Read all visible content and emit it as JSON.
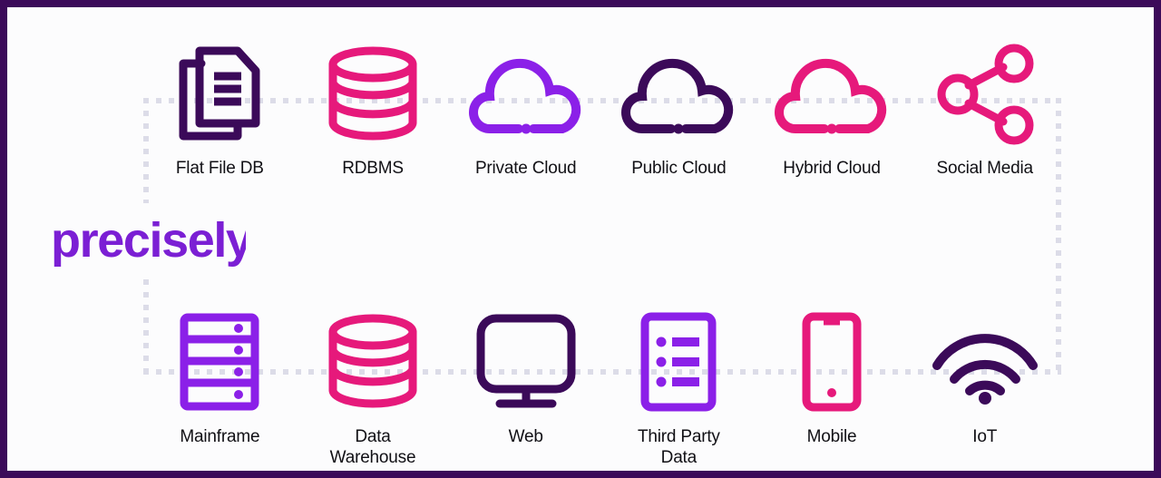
{
  "frame": {
    "border_color": "#3B0A59",
    "background_color": "#FCFCFD",
    "dash_color": "#DCDCE8"
  },
  "brand": {
    "logo_text": "precisely",
    "logo_color": "#7B1FD4"
  },
  "palette": {
    "dark_purple": "#3B0A59",
    "bright_purple": "#8B20E8",
    "pink": "#E6197B"
  },
  "rows": [
    {
      "name": "top-row",
      "items": [
        {
          "label": "Flat File DB",
          "icon": "documents-icon",
          "color": "#3B0A59"
        },
        {
          "label": "RDBMS",
          "icon": "database-icon",
          "color": "#E6197B"
        },
        {
          "label": "Private Cloud",
          "icon": "cloud-icon",
          "color": "#8B20E8"
        },
        {
          "label": "Public Cloud",
          "icon": "cloud-icon",
          "color": "#3B0A59"
        },
        {
          "label": "Hybrid Cloud",
          "icon": "cloud-icon",
          "color": "#E6197B"
        },
        {
          "label": "Social Media",
          "icon": "share-nodes-icon",
          "color": "#E6197B"
        }
      ]
    },
    {
      "name": "bottom-row",
      "items": [
        {
          "label": "Mainframe",
          "icon": "server-rack-icon",
          "color": "#8B20E8"
        },
        {
          "label": "Data\nWarehouse",
          "icon": "database-icon",
          "color": "#E6197B"
        },
        {
          "label": "Web",
          "icon": "monitor-icon",
          "color": "#3B0A59"
        },
        {
          "label": "Third Party\nData",
          "icon": "document-list-icon",
          "color": "#8B20E8"
        },
        {
          "label": "Mobile",
          "icon": "smartphone-icon",
          "color": "#E6197B"
        },
        {
          "label": "IoT",
          "icon": "wifi-signal-icon",
          "color": "#3B0A59"
        }
      ]
    }
  ]
}
